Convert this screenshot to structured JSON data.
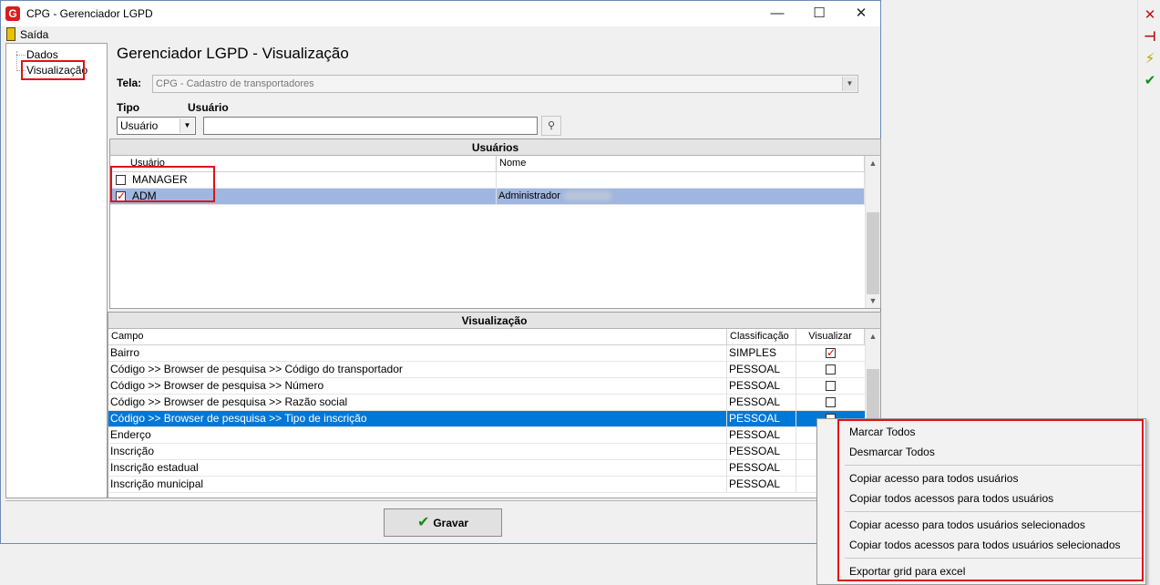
{
  "window": {
    "title": "CPG - Gerenciador LGPD",
    "minimize_glyph": "—",
    "maximize_glyph": "☐",
    "close_glyph": "✕"
  },
  "menu": {
    "exit_label": "Saída"
  },
  "tree": {
    "items": [
      "Dados",
      "Visualização"
    ]
  },
  "page": {
    "title": "Gerenciador LGPD - Visualização",
    "screen_label": "Tela:",
    "screen_value": "CPG - Cadastro de transportadores",
    "type_label": "Tipo",
    "user_label": "Usuário",
    "type_value": "Usuário",
    "user_input_value": "",
    "search_glyph": "🔍"
  },
  "users_grid": {
    "caption": "Usuários",
    "columns": [
      "Usuário",
      "Nome"
    ],
    "rows": [
      {
        "user": "MANAGER",
        "name": "",
        "checked": false
      },
      {
        "user": "ADM",
        "name": "Administrador",
        "checked": true
      }
    ]
  },
  "view_grid": {
    "caption": "Visualização",
    "columns": [
      "Campo",
      "Classificação",
      "Visualizar"
    ],
    "rows": [
      {
        "field": "Bairro",
        "class": "SIMPLES",
        "visible": true
      },
      {
        "field": "Código >> Browser de pesquisa >> Código do transportador",
        "class": "PESSOAL",
        "visible": false
      },
      {
        "field": "Código >> Browser de pesquisa >> Número",
        "class": "PESSOAL",
        "visible": false
      },
      {
        "field": "Código >> Browser de pesquisa >> Razão social",
        "class": "PESSOAL",
        "visible": false
      },
      {
        "field": "Código >> Browser de pesquisa >> Tipo de inscrição",
        "class": "PESSOAL",
        "visible": false
      },
      {
        "field": "Enderço",
        "class": "PESSOAL",
        "visible": false
      },
      {
        "field": "Inscrição",
        "class": "PESSOAL",
        "visible": false
      },
      {
        "field": "Inscrição estadual",
        "class": "PESSOAL",
        "visible": false
      },
      {
        "field": "Inscrição municipal",
        "class": "PESSOAL",
        "visible": false
      }
    ]
  },
  "save_button": {
    "label": "Gravar"
  },
  "context_menu": {
    "items": [
      "Marcar Todos",
      "Desmarcar Todos",
      "Copiar acesso para todos usuários",
      "Copiar todos acessos para todos usuários",
      "Copiar acesso para todos usuários selecionados",
      "Copiar todos acessos para todos usuários selecionados",
      "Exportar grid para excel"
    ]
  },
  "toolbar": {
    "close_glyph": "✕",
    "pin_glyph": "⊣",
    "flash_glyph": "⚡",
    "ok_glyph": "✔"
  },
  "colors": {
    "highlight_red": "#e01212",
    "selection_blue": "#0078d7",
    "selection_gray": "#9fb6e0"
  }
}
